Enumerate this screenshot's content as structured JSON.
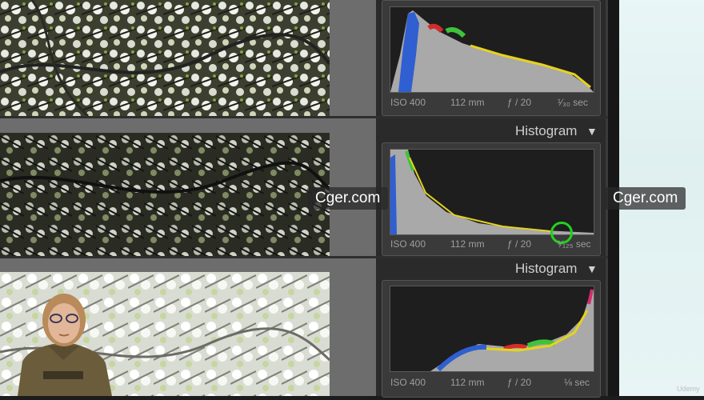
{
  "watermark": "Cger.com",
  "panels": [
    {
      "title": "",
      "meta": {
        "iso": "ISO 400",
        "focal": "112 mm",
        "aperture": "ƒ / 20",
        "shutter": "¹⁄₃₀ sec"
      },
      "exposure": "normal"
    },
    {
      "title": "Histogram",
      "meta": {
        "iso": "ISO 400",
        "focal": "112 mm",
        "aperture": "ƒ / 20",
        "shutter": "¹⁄₁₂₅ sec"
      },
      "exposure": "under"
    },
    {
      "title": "Histogram",
      "meta": {
        "iso": "ISO 400",
        "focal": "112 mm",
        "aperture": "ƒ / 20",
        "shutter": "⅛ sec"
      },
      "exposure": "over"
    }
  ],
  "brand": "Udemy",
  "colors": {
    "highlight_circle": "#22d21e",
    "panel_bg": "#2a2a2a",
    "gap_gray": "#6d6d6d"
  }
}
